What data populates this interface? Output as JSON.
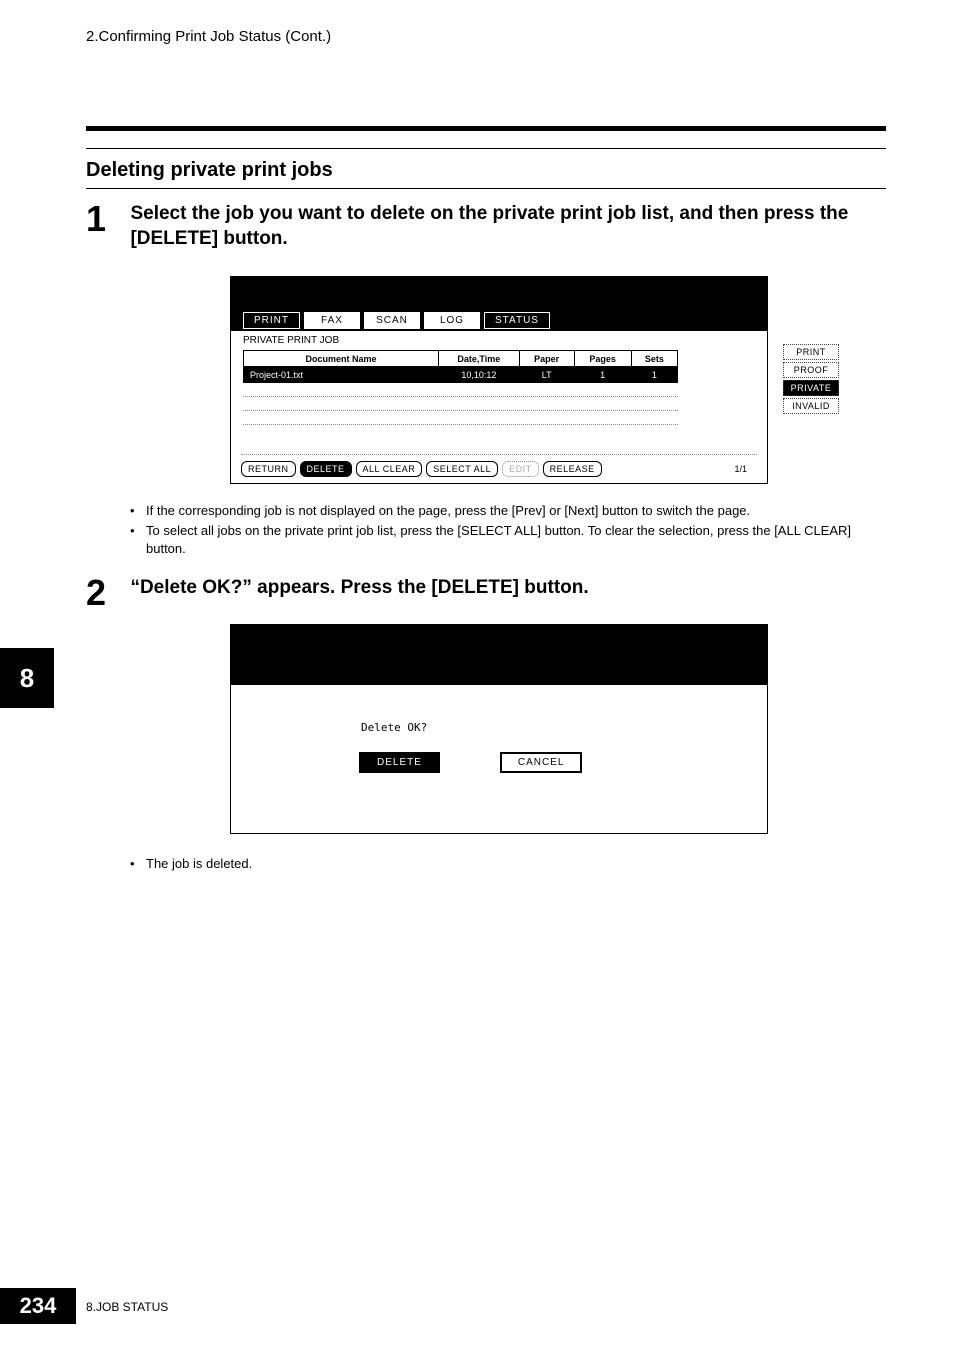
{
  "header": {
    "breadcrumb": "2.Confirming Print Job Status (Cont.)"
  },
  "section": {
    "title": "Deleting private print jobs"
  },
  "step1": {
    "number": "1",
    "text": "Select the job you want to delete on the private print job list, and then press the [DELETE] button."
  },
  "step2": {
    "number": "2",
    "text": "“Delete OK?” appears. Press the [DELETE] button."
  },
  "shot1": {
    "tabs": {
      "print": "PRINT",
      "fax": "FAX",
      "scan": "SCAN",
      "log": "LOG",
      "status": "STATUS"
    },
    "label": "PRIVATE PRINT JOB",
    "columns": {
      "docname": "Document Name",
      "datetime": "Date,Time",
      "paper": "Paper",
      "pages": "Pages",
      "sets": "Sets"
    },
    "row1": {
      "docname": "Project-01.txt",
      "datetime": "10,10:12",
      "paper": "LT",
      "pages": "1",
      "sets": "1"
    },
    "side": {
      "print": "PRINT",
      "proof": "PROOF",
      "private": "PRIVATE",
      "invalid": "INVALID"
    },
    "bottom": {
      "return": "RETURN",
      "delete": "DELETE",
      "allclear": "ALL CLEAR",
      "selectall": "SELECT ALL",
      "edit": "EDIT",
      "release": "RELEASE",
      "page": "1/1"
    }
  },
  "bullets1": {
    "b1": "If the corresponding job is not displayed on the page, press the [Prev] or [Next] button to switch the page.",
    "b2": "To select all jobs on the private print job list, press the [SELECT ALL] button. To clear the selection, press the [ALL CLEAR] button."
  },
  "shot2": {
    "prompt": "Delete OK?",
    "delete": "DELETE",
    "cancel": "CANCEL"
  },
  "bullets2": {
    "b1": "The job is deleted."
  },
  "chapter": {
    "tab": "8"
  },
  "footer": {
    "pagenum": "234",
    "text": "8.JOB STATUS"
  }
}
